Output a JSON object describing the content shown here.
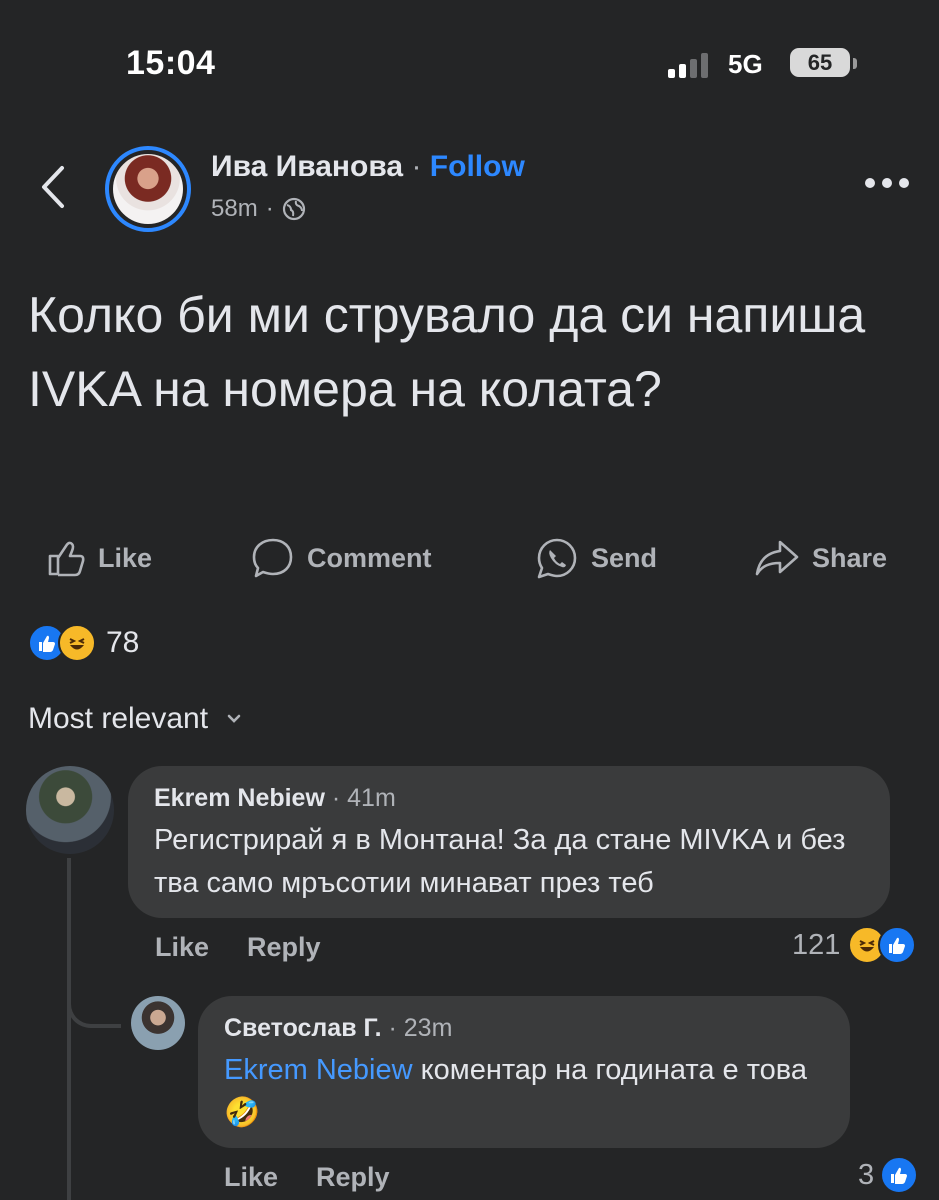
{
  "status_bar": {
    "time": "15:04",
    "network": "5G",
    "battery": "65"
  },
  "post": {
    "author": "Ива Иванова",
    "separator": "·",
    "follow_label": "Follow",
    "age": "58m",
    "meta_separator": "·",
    "privacy_icon": "globe-icon",
    "text": "Колко би ми струвало да си напиша IVKA на номера на колата?"
  },
  "actions": {
    "like": "Like",
    "comment": "Comment",
    "send": "Send",
    "share": "Share"
  },
  "reactions": {
    "count": "78",
    "types": [
      "like",
      "haha"
    ]
  },
  "sort": {
    "label": "Most relevant"
  },
  "comments": [
    {
      "author": "Ekrem Nebiew",
      "time": "41m",
      "text": "Регистрирай я в Монтана! За да стане MIVKA и без тва само мръсотии минават през теб",
      "like_label": "Like",
      "reply_label": "Reply",
      "reaction_count": "121",
      "reaction_types": [
        "haha",
        "like"
      ]
    },
    {
      "author": "Светослав Г.",
      "time": "23m",
      "mention": "Ekrem Nebiew",
      "text": "коментар на годината е това",
      "emoji": "🤣",
      "like_label": "Like",
      "reply_label": "Reply",
      "reaction_count": "3",
      "reaction_types": [
        "like"
      ]
    }
  ],
  "colors": {
    "background": "#242526",
    "accent": "#2d88ff",
    "bubble": "#3a3b3c",
    "secondary_text": "#b0b3b8"
  }
}
